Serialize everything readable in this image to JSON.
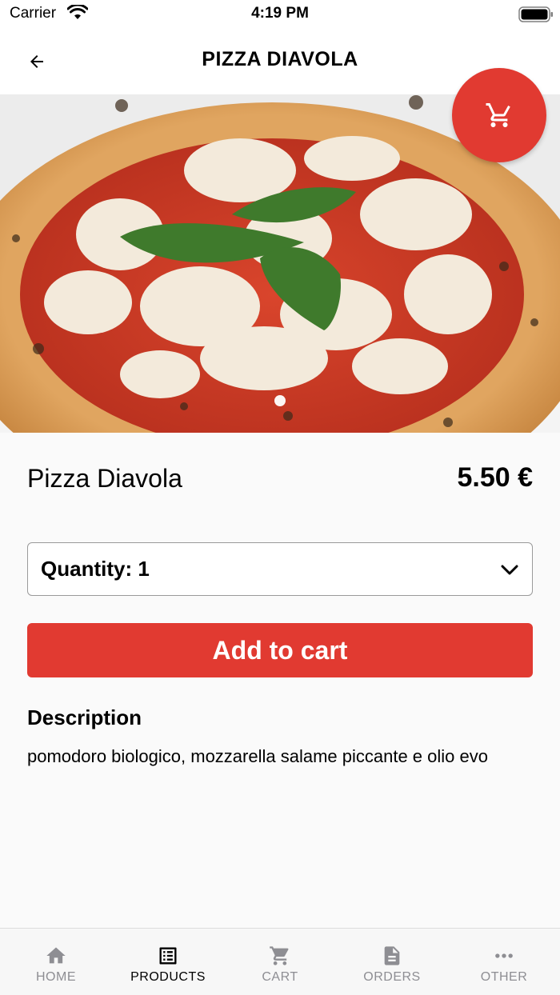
{
  "status_bar": {
    "carrier": "Carrier",
    "time": "4:19 PM"
  },
  "nav": {
    "title": "PIZZA DIAVOLA",
    "back_icon": "arrow-left-icon"
  },
  "hero": {
    "pages": 1,
    "active_page": 1,
    "cart_icon": "cart-icon",
    "accent_color": "#e13a31"
  },
  "product": {
    "name": "Pizza Diavola",
    "price": "5.50 €",
    "quantity_label": "Quantity: 1",
    "add_to_cart": "Add to cart",
    "description_title": "Description",
    "description": "pomodoro biologico, mozzarella salame piccante e olio evo"
  },
  "tabs": [
    {
      "label": "HOME",
      "icon": "home-icon",
      "active": false
    },
    {
      "label": "PRODUCTS",
      "icon": "list-icon",
      "active": true
    },
    {
      "label": "CART",
      "icon": "cart-icon",
      "active": false
    },
    {
      "label": "ORDERS",
      "icon": "document-icon",
      "active": false
    },
    {
      "label": "OTHER",
      "icon": "more-icon",
      "active": false
    }
  ]
}
